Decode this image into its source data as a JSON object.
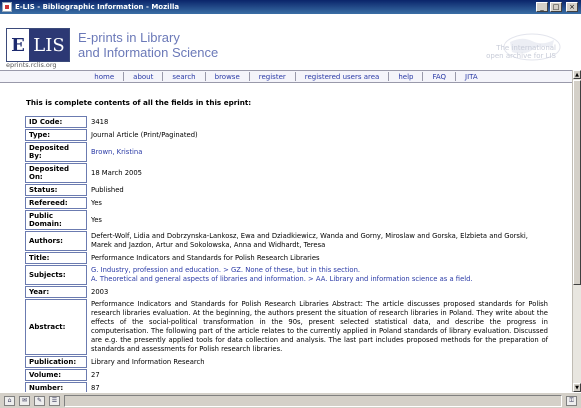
{
  "window": {
    "title": "E-LIS - Bibliographic Information - Mozilla",
    "buttons": {
      "minimize": "_",
      "maximize": "□",
      "close": "×"
    }
  },
  "header": {
    "logo_e": "E",
    "logo_lis": "LIS",
    "logo_url": "eprints.rclis.org",
    "site_title_line1": "E-prints in Library",
    "site_title_line2": "and Information Science",
    "tagline_line1": "The international",
    "tagline_line2": "open archive for LIS"
  },
  "nav": {
    "items": [
      "home",
      "about",
      "search",
      "browse",
      "register",
      "registered users area",
      "help",
      "FAQ",
      "JITA"
    ]
  },
  "content": {
    "intro": "This is complete contents of all the fields in this eprint:",
    "fields": {
      "id_code": {
        "label": "ID Code:",
        "value": "3418"
      },
      "type": {
        "label": "Type:",
        "value": "Journal Article (Print/Paginated)"
      },
      "deposited_by": {
        "label": "Deposited By:",
        "value": "Brown, Kristina"
      },
      "deposited_on": {
        "label": "Deposited On:",
        "value": "18 March 2005"
      },
      "status": {
        "label": "Status:",
        "value": "Published"
      },
      "refereed": {
        "label": "Refereed:",
        "value": "Yes"
      },
      "public_domain": {
        "label": "Public Domain:",
        "value": "Yes"
      },
      "authors": {
        "label": "Authors:",
        "value": "Defert-Wolf, Lidia and Dobrzynska-Lankosz, Ewa and Dziadkiewicz, Wanda and Gorny, Miroslaw and Gorska, Elzbieta and Gorski, Marek and Jazdon, Artur and Sokolowska, Anna and Widhardt, Teresa"
      },
      "title": {
        "label": "Title:",
        "value": "Performance Indicators and Standards for Polish Research Libraries"
      },
      "subjects": {
        "label": "Subjects:",
        "line1": "G. Industry, profession and education. > GZ. None of these, but in this section.",
        "line2": "A. Theoretical and general aspects of libraries and information. > AA. Library and information science as a field."
      },
      "year": {
        "label": "Year:",
        "value": "2003"
      },
      "abstract": {
        "label": "Abstract:",
        "value": "Performance Indicators and Standards for Polish Research Libraries Abstract: The article discusses proposed standards for Polish research libraries evaluation. At the beginning, the authors present the situation of research libraries in Poland. They write about the effects of the social-political transformation in the 90s, present selected statistical data, and describe the progress in computerisation. The following part of the article relates to the currently applied in Poland standards of library evaluation. Discussed are e.g. the presently applied tools for data collection and analysis. The last part includes proposed methods for the preparation of standards and assessments for Polish research libraries."
      },
      "publication": {
        "label": "Publication:",
        "value": "Library and Information Research"
      },
      "volume": {
        "label": "Volume:",
        "value": "27"
      },
      "number": {
        "label": "Number:",
        "value": "87"
      }
    }
  }
}
